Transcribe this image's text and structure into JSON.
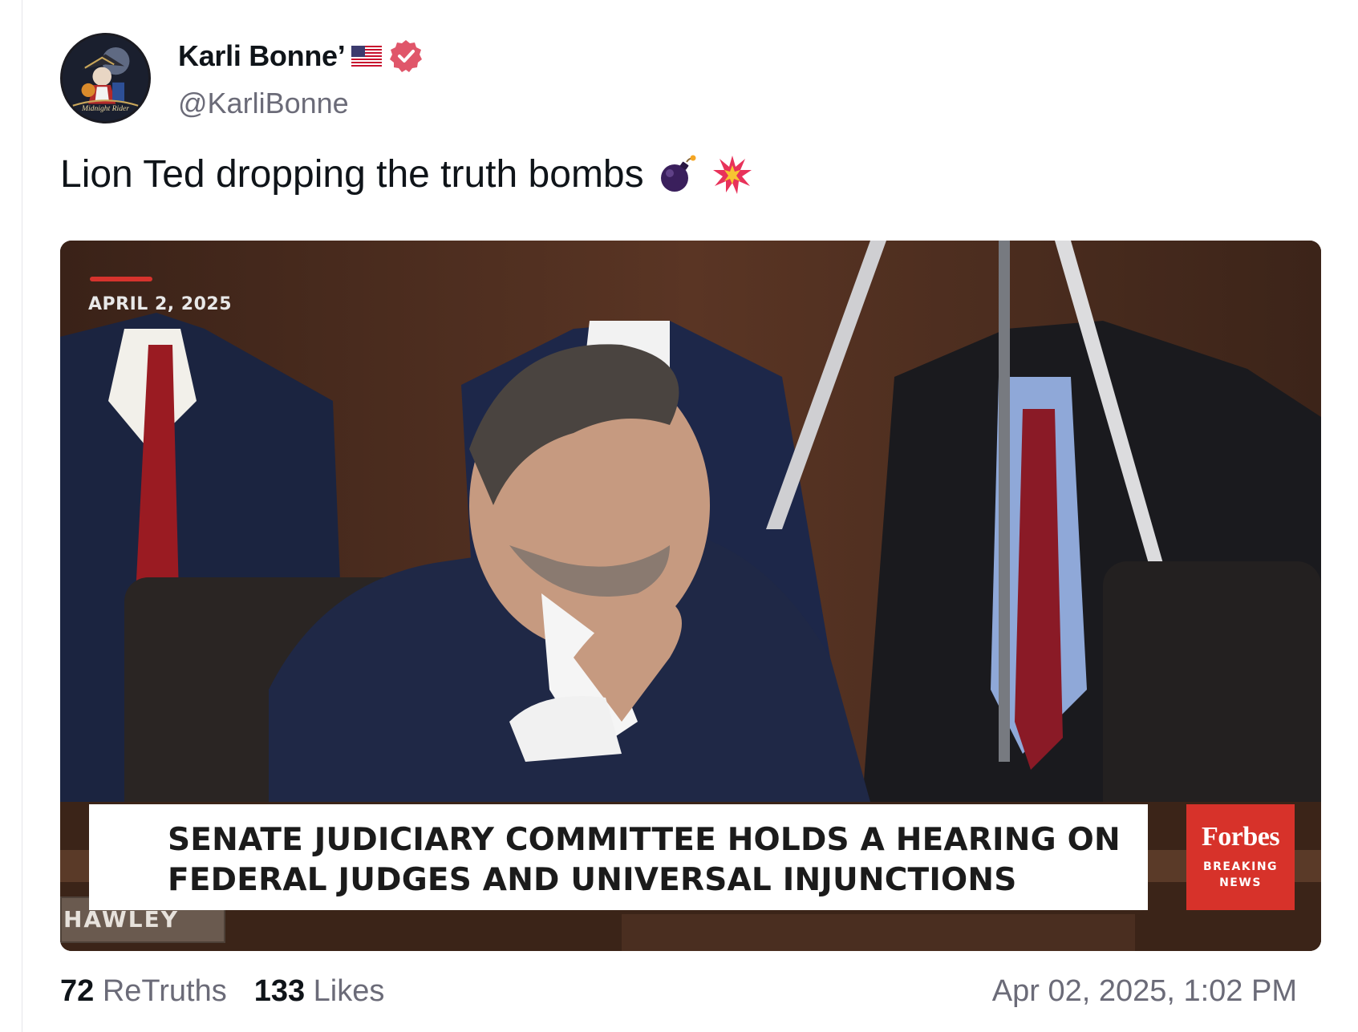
{
  "author": {
    "display_name": "Karli Bonne’",
    "handle": "@KarliBonne",
    "avatar_text": "Midnight Rider"
  },
  "post": {
    "text": "Lion Ted dropping the truth bombs",
    "emojis": [
      "bomb-emoji",
      "collision-emoji"
    ]
  },
  "video": {
    "date_stamp": "APRIL 2, 2025",
    "chyron_line1": "SENATE JUDICIARY COMMITTEE HOLDS A HEARING ON",
    "chyron_line2": "FEDERAL JUDGES AND UNIVERSAL INJUNCTIONS",
    "brand": "Forbes",
    "brand_sub1": "BREAKING",
    "brand_sub2": "NEWS",
    "nameplate": "HAWLEY"
  },
  "stats": {
    "retruths_count": "72",
    "retruths_label": "ReTruths",
    "likes_count": "133",
    "likes_label": "Likes"
  },
  "timestamp": "Apr 02, 2025, 1:02 PM",
  "colors": {
    "verified": "#e0566a",
    "forbes_red": "#d7322a",
    "muted_text": "#6b6b78"
  }
}
